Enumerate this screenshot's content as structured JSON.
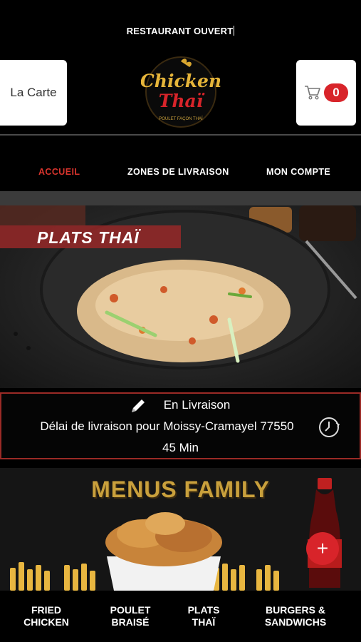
{
  "header": {
    "status": "RESTAURANT OUVERT",
    "menu_button": "La Carte",
    "cart_count": "0",
    "logo_text_top": "Chicken",
    "logo_text_bottom": "Thaï",
    "logo_tagline": "POULET FAÇON THAÏ"
  },
  "nav": {
    "items": [
      "ACCUEIL",
      "ZONES DE LIVRAISON",
      "MON COMPTE"
    ],
    "active": "ACCUEIL"
  },
  "hero": {
    "label": "PLATS THAÏ"
  },
  "delivery": {
    "mode": "En Livraison",
    "delay_text": "Délai de livraison pour Moissy-Cramayel 77550",
    "duration": "45 Min"
  },
  "promo": {
    "title": "MENUS FAMILY"
  },
  "fab": {
    "label": "+"
  },
  "bottom_nav": {
    "items": [
      {
        "line1": "FRIED",
        "line2": "CHICKEN"
      },
      {
        "line1": "POULET",
        "line2": "BRAISÉ"
      },
      {
        "line1": "PLATS",
        "line2": "THAÏ"
      },
      {
        "line1": "BURGERS &",
        "line2": "SANDWICHS"
      }
    ]
  },
  "colors": {
    "accent": "#d8242a",
    "active_nav": "#d8342d",
    "background": "#000000",
    "promo_title": "#c9a03c"
  },
  "icons": [
    "pencil-icon",
    "clock-icon",
    "cart-icon",
    "plus-icon"
  ]
}
